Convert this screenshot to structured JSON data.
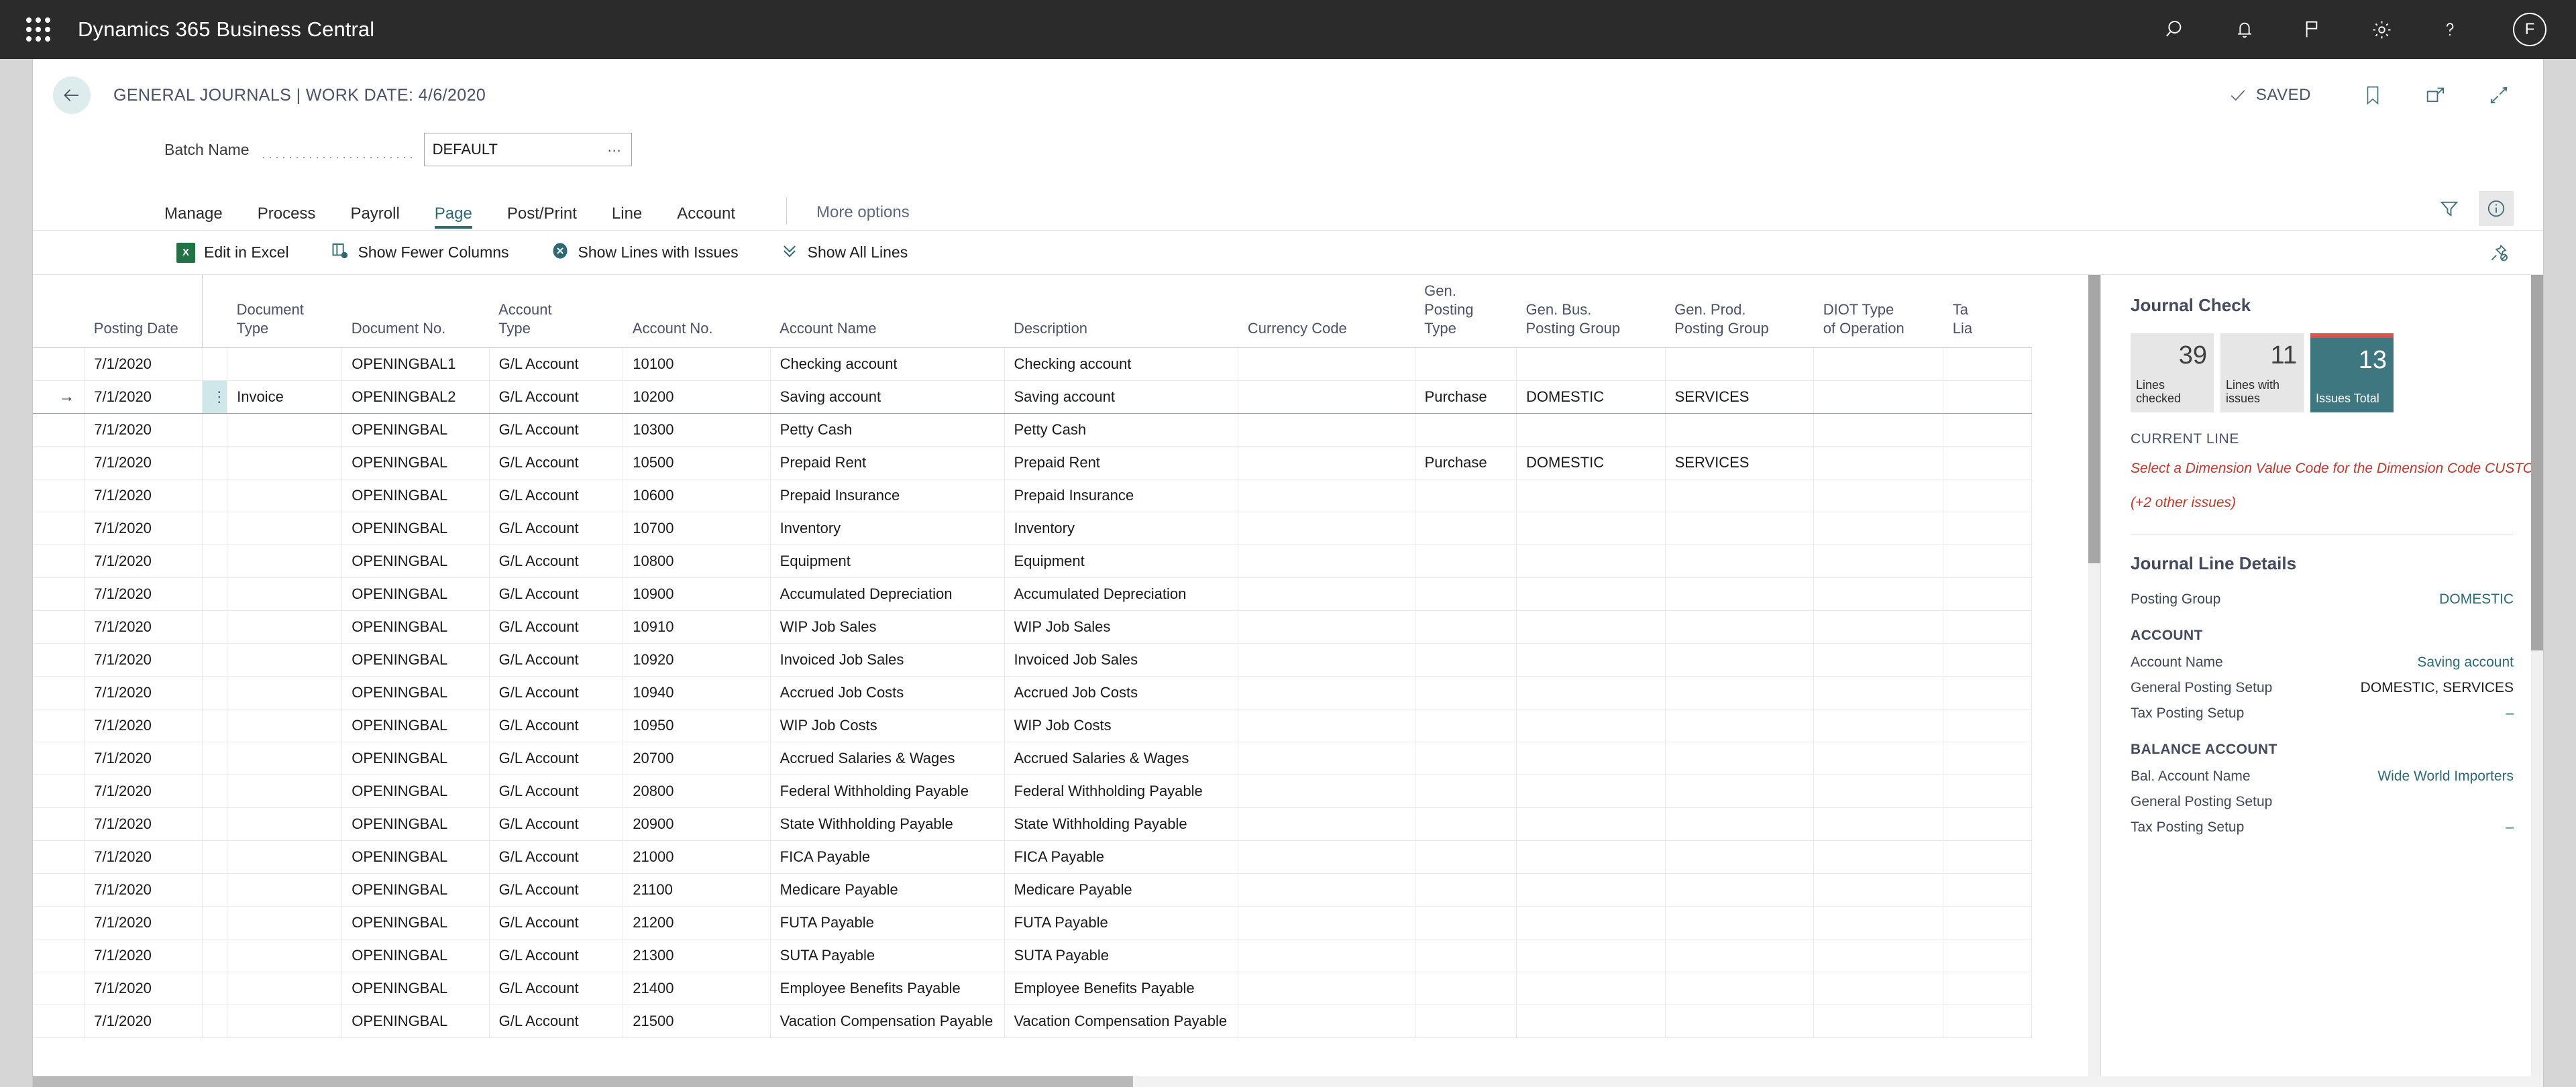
{
  "appbar": {
    "product_title": "Dynamics 365 Business Central",
    "waffle": "app-launcher-icon",
    "icons": [
      "search-icon",
      "notifications-bell-icon",
      "flag-icon",
      "settings-gear-icon",
      "help-question-icon"
    ],
    "avatar_initial": "F"
  },
  "header": {
    "back": "back-arrow-icon",
    "title": "GENERAL JOURNALS | WORK DATE: 4/6/2020",
    "status": "SAVED",
    "icons": [
      "bookmark-icon",
      "open-in-new-window-icon",
      "collapse-icon"
    ]
  },
  "batch": {
    "label": "Batch Name",
    "value": "DEFAULT",
    "lookup": "…"
  },
  "ribbon": {
    "tabs": [
      {
        "label": "Manage",
        "active": false
      },
      {
        "label": "Process",
        "active": false
      },
      {
        "label": "Payroll",
        "active": false
      },
      {
        "label": "Page",
        "active": true
      },
      {
        "label": "Post/Print",
        "active": false
      },
      {
        "label": "Line",
        "active": false
      },
      {
        "label": "Account",
        "active": false
      }
    ],
    "more_options": "More options",
    "filter_icon": "filter-funnel-icon",
    "info_icon": "info-circle-icon"
  },
  "actionbar": {
    "actions": [
      {
        "label": "Edit in Excel",
        "icon": "excel-icon"
      },
      {
        "label": "Show Fewer Columns",
        "icon": "fewer-columns-icon"
      },
      {
        "label": "Show Lines with Issues",
        "icon": "issues-circle-icon"
      },
      {
        "label": "Show All Lines",
        "icon": "chevrons-down-icon"
      }
    ],
    "pin_icon": "unpin-icon"
  },
  "grid": {
    "columns": [
      "Posting Date",
      "Document Type",
      "Document No.",
      "Account Type",
      "Account No.",
      "Account Name",
      "Description",
      "Currency Code",
      "Gen. Posting Type",
      "Gen. Bus. Posting Group",
      "Gen. Prod. Posting Group",
      "DIOT Type of Operation",
      "Tax Liable"
    ],
    "columns_wrapped": [
      {
        "l1": "",
        "l2": "Posting Date"
      },
      {
        "l1": "Document",
        "l2": "Type"
      },
      {
        "l1": "",
        "l2": "Document No."
      },
      {
        "l1": "Account",
        "l2": "Type"
      },
      {
        "l1": "",
        "l2": "Account No."
      },
      {
        "l1": "",
        "l2": "Account Name"
      },
      {
        "l1": "",
        "l2": "Description"
      },
      {
        "l1": "",
        "l2": "Currency Code"
      },
      {
        "l1": "Gen. Posting",
        "l2": "Type"
      },
      {
        "l1": "Gen. Bus.",
        "l2": "Posting Group"
      },
      {
        "l1": "Gen. Prod.",
        "l2": "Posting Group"
      },
      {
        "l1": "DIOT Type",
        "l2": "of Operation"
      },
      {
        "l1": "Ta",
        "l2": "Lia"
      }
    ],
    "rows": [
      {
        "selected": false,
        "posting_date": "7/1/2020",
        "document_type": "",
        "document_no": "OPENINGBAL1",
        "account_type": "G/L Account",
        "account_no": "10100",
        "account_name": "Checking account",
        "description": "Checking account",
        "currency_code": "",
        "gen_posting_type": "",
        "gen_bus_posting_group": "",
        "gen_prod_posting_group": "",
        "diot_type": "",
        "tax_liable": ""
      },
      {
        "selected": true,
        "posting_date": "7/1/2020",
        "document_type": "Invoice",
        "document_no": "OPENINGBAL2",
        "account_type": "G/L Account",
        "account_no": "10200",
        "account_name": "Saving account",
        "description": "Saving account",
        "currency_code": "",
        "gen_posting_type": "Purchase",
        "gen_bus_posting_group": "DOMESTIC",
        "gen_prod_posting_group": "SERVICES",
        "diot_type": "",
        "tax_liable": ""
      },
      {
        "selected": false,
        "posting_date": "7/1/2020",
        "document_type": "",
        "document_no": "OPENINGBAL",
        "account_type": "G/L Account",
        "account_no": "10300",
        "account_name": "Petty Cash",
        "description": "Petty Cash",
        "currency_code": "",
        "gen_posting_type": "",
        "gen_bus_posting_group": "",
        "gen_prod_posting_group": "",
        "diot_type": "",
        "tax_liable": ""
      },
      {
        "selected": false,
        "posting_date": "7/1/2020",
        "document_type": "",
        "document_no": "OPENINGBAL",
        "account_type": "G/L Account",
        "account_no": "10500",
        "account_name": "Prepaid Rent",
        "description": "Prepaid Rent",
        "currency_code": "",
        "gen_posting_type": "Purchase",
        "gen_bus_posting_group": "DOMESTIC",
        "gen_prod_posting_group": "SERVICES",
        "diot_type": "",
        "tax_liable": ""
      },
      {
        "selected": false,
        "posting_date": "7/1/2020",
        "document_type": "",
        "document_no": "OPENINGBAL",
        "account_type": "G/L Account",
        "account_no": "10600",
        "account_name": "Prepaid Insurance",
        "description": "Prepaid Insurance",
        "currency_code": "",
        "gen_posting_type": "",
        "gen_bus_posting_group": "",
        "gen_prod_posting_group": "",
        "diot_type": "",
        "tax_liable": ""
      },
      {
        "selected": false,
        "posting_date": "7/1/2020",
        "document_type": "",
        "document_no": "OPENINGBAL",
        "account_type": "G/L Account",
        "account_no": "10700",
        "account_name": "Inventory",
        "description": "Inventory",
        "currency_code": "",
        "gen_posting_type": "",
        "gen_bus_posting_group": "",
        "gen_prod_posting_group": "",
        "diot_type": "",
        "tax_liable": ""
      },
      {
        "selected": false,
        "posting_date": "7/1/2020",
        "document_type": "",
        "document_no": "OPENINGBAL",
        "account_type": "G/L Account",
        "account_no": "10800",
        "account_name": "Equipment",
        "description": "Equipment",
        "currency_code": "",
        "gen_posting_type": "",
        "gen_bus_posting_group": "",
        "gen_prod_posting_group": "",
        "diot_type": "",
        "tax_liable": ""
      },
      {
        "selected": false,
        "posting_date": "7/1/2020",
        "document_type": "",
        "document_no": "OPENINGBAL",
        "account_type": "G/L Account",
        "account_no": "10900",
        "account_name": "Accumulated Depreciation",
        "description": "Accumulated Depreciation",
        "currency_code": "",
        "gen_posting_type": "",
        "gen_bus_posting_group": "",
        "gen_prod_posting_group": "",
        "diot_type": "",
        "tax_liable": ""
      },
      {
        "selected": false,
        "posting_date": "7/1/2020",
        "document_type": "",
        "document_no": "OPENINGBAL",
        "account_type": "G/L Account",
        "account_no": "10910",
        "account_name": "WIP Job Sales",
        "description": "WIP Job Sales",
        "currency_code": "",
        "gen_posting_type": "",
        "gen_bus_posting_group": "",
        "gen_prod_posting_group": "",
        "diot_type": "",
        "tax_liable": ""
      },
      {
        "selected": false,
        "posting_date": "7/1/2020",
        "document_type": "",
        "document_no": "OPENINGBAL",
        "account_type": "G/L Account",
        "account_no": "10920",
        "account_name": "Invoiced Job Sales",
        "description": "Invoiced Job Sales",
        "currency_code": "",
        "gen_posting_type": "",
        "gen_bus_posting_group": "",
        "gen_prod_posting_group": "",
        "diot_type": "",
        "tax_liable": ""
      },
      {
        "selected": false,
        "posting_date": "7/1/2020",
        "document_type": "",
        "document_no": "OPENINGBAL",
        "account_type": "G/L Account",
        "account_no": "10940",
        "account_name": "Accrued Job Costs",
        "description": "Accrued Job Costs",
        "currency_code": "",
        "gen_posting_type": "",
        "gen_bus_posting_group": "",
        "gen_prod_posting_group": "",
        "diot_type": "",
        "tax_liable": ""
      },
      {
        "selected": false,
        "posting_date": "7/1/2020",
        "document_type": "",
        "document_no": "OPENINGBAL",
        "account_type": "G/L Account",
        "account_no": "10950",
        "account_name": "WIP Job Costs",
        "description": "WIP Job Costs",
        "currency_code": "",
        "gen_posting_type": "",
        "gen_bus_posting_group": "",
        "gen_prod_posting_group": "",
        "diot_type": "",
        "tax_liable": ""
      },
      {
        "selected": false,
        "posting_date": "7/1/2020",
        "document_type": "",
        "document_no": "OPENINGBAL",
        "account_type": "G/L Account",
        "account_no": "20700",
        "account_name": "Accrued Salaries & Wages",
        "description": "Accrued Salaries & Wages",
        "currency_code": "",
        "gen_posting_type": "",
        "gen_bus_posting_group": "",
        "gen_prod_posting_group": "",
        "diot_type": "",
        "tax_liable": ""
      },
      {
        "selected": false,
        "posting_date": "7/1/2020",
        "document_type": "",
        "document_no": "OPENINGBAL",
        "account_type": "G/L Account",
        "account_no": "20800",
        "account_name": "Federal Withholding Payable",
        "description": "Federal Withholding Payable",
        "currency_code": "",
        "gen_posting_type": "",
        "gen_bus_posting_group": "",
        "gen_prod_posting_group": "",
        "diot_type": "",
        "tax_liable": ""
      },
      {
        "selected": false,
        "posting_date": "7/1/2020",
        "document_type": "",
        "document_no": "OPENINGBAL",
        "account_type": "G/L Account",
        "account_no": "20900",
        "account_name": "State Withholding Payable",
        "description": "State Withholding Payable",
        "currency_code": "",
        "gen_posting_type": "",
        "gen_bus_posting_group": "",
        "gen_prod_posting_group": "",
        "diot_type": "",
        "tax_liable": ""
      },
      {
        "selected": false,
        "posting_date": "7/1/2020",
        "document_type": "",
        "document_no": "OPENINGBAL",
        "account_type": "G/L Account",
        "account_no": "21000",
        "account_name": "FICA Payable",
        "description": "FICA Payable",
        "currency_code": "",
        "gen_posting_type": "",
        "gen_bus_posting_group": "",
        "gen_prod_posting_group": "",
        "diot_type": "",
        "tax_liable": ""
      },
      {
        "selected": false,
        "posting_date": "7/1/2020",
        "document_type": "",
        "document_no": "OPENINGBAL",
        "account_type": "G/L Account",
        "account_no": "21100",
        "account_name": "Medicare Payable",
        "description": "Medicare Payable",
        "currency_code": "",
        "gen_posting_type": "",
        "gen_bus_posting_group": "",
        "gen_prod_posting_group": "",
        "diot_type": "",
        "tax_liable": ""
      },
      {
        "selected": false,
        "posting_date": "7/1/2020",
        "document_type": "",
        "document_no": "OPENINGBAL",
        "account_type": "G/L Account",
        "account_no": "21200",
        "account_name": "FUTA Payable",
        "description": "FUTA Payable",
        "currency_code": "",
        "gen_posting_type": "",
        "gen_bus_posting_group": "",
        "gen_prod_posting_group": "",
        "diot_type": "",
        "tax_liable": ""
      },
      {
        "selected": false,
        "posting_date": "7/1/2020",
        "document_type": "",
        "document_no": "OPENINGBAL",
        "account_type": "G/L Account",
        "account_no": "21300",
        "account_name": "SUTA Payable",
        "description": "SUTA Payable",
        "currency_code": "",
        "gen_posting_type": "",
        "gen_bus_posting_group": "",
        "gen_prod_posting_group": "",
        "diot_type": "",
        "tax_liable": ""
      },
      {
        "selected": false,
        "posting_date": "7/1/2020",
        "document_type": "",
        "document_no": "OPENINGBAL",
        "account_type": "G/L Account",
        "account_no": "21400",
        "account_name": "Employee Benefits Payable",
        "description": "Employee Benefits Payable",
        "currency_code": "",
        "gen_posting_type": "",
        "gen_bus_posting_group": "",
        "gen_prod_posting_group": "",
        "diot_type": "",
        "tax_liable": ""
      },
      {
        "selected": false,
        "posting_date": "7/1/2020",
        "document_type": "",
        "document_no": "OPENINGBAL",
        "account_type": "G/L Account",
        "account_no": "21500",
        "account_name": "Vacation Compensation Payable",
        "description": "Vacation Compensation Payable",
        "currency_code": "",
        "gen_posting_type": "",
        "gen_bus_posting_group": "",
        "gen_prod_posting_group": "",
        "diot_type": "",
        "tax_liable": ""
      }
    ]
  },
  "factbox": {
    "journal_check": {
      "title": "Journal Check",
      "tiles": [
        {
          "value": "39",
          "label": "Lines checked",
          "accent": false
        },
        {
          "value": "11",
          "label": "Lines with issues",
          "accent": false
        },
        {
          "value": "13",
          "label": "Issues Total",
          "accent": true
        }
      ],
      "current_line_label": "CURRENT LINE",
      "error_message": "Select a Dimension Value Code for the Dimension Code CUSTOMERGROUP",
      "other_issues": "(+2 other issues)"
    },
    "line_details": {
      "title": "Journal Line Details",
      "posting_group_label": "Posting Group",
      "posting_group_value": "DOMESTIC",
      "account_group": "ACCOUNT",
      "account_rows": [
        {
          "key": "Account Name",
          "value": "Saving account",
          "link": true
        },
        {
          "key": "General Posting Setup",
          "value": "DOMESTIC, SERVICES",
          "link": false
        },
        {
          "key": "Tax Posting Setup",
          "value": "–",
          "link": false
        }
      ],
      "balance_group": "BALANCE ACCOUNT",
      "balance_rows": [
        {
          "key": "Bal. Account Name",
          "value": "Wide World Importers",
          "link": true
        },
        {
          "key": "General Posting Setup",
          "value": "",
          "link": false
        },
        {
          "key": "Tax Posting Setup",
          "value": "–",
          "link": false
        }
      ]
    }
  },
  "colors": {
    "accent_teal": "#2b6b74",
    "tile_teal": "#3f7780",
    "error_red": "#c0392b",
    "appbar_bg": "#2b2b2b"
  }
}
